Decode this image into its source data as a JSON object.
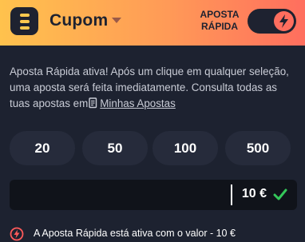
{
  "header": {
    "title": "Cupom",
    "quick_bet_label_line1": "APOSTA",
    "quick_bet_label_line2": "RÁPIDA",
    "toggle_on": true
  },
  "info": {
    "text": "Aposta Rápida ativa! Após um clique em qualquer seleção, uma aposta será feita imediatamente. Consulta todas as tuas apostas em",
    "link": "Minhas Apostas"
  },
  "amounts": [
    "20",
    "50",
    "100",
    "500"
  ],
  "stake": {
    "value": "10 €"
  },
  "footer": {
    "text": "A Aposta Rápida está ativa com o valor - 10 €"
  },
  "colors": {
    "header_gradient_start": "#ffc24d",
    "header_gradient_end": "#ff6e5e",
    "background": "#1d2230",
    "accent_green": "#34c759",
    "warning_red": "#ff5a5a"
  },
  "icons": {
    "menu": "menu-icon",
    "caret": "chevron-down-icon",
    "toggle": "lightning-icon",
    "link": "document-icon",
    "confirm": "check-icon",
    "footer": "lightning-warning-icon"
  }
}
